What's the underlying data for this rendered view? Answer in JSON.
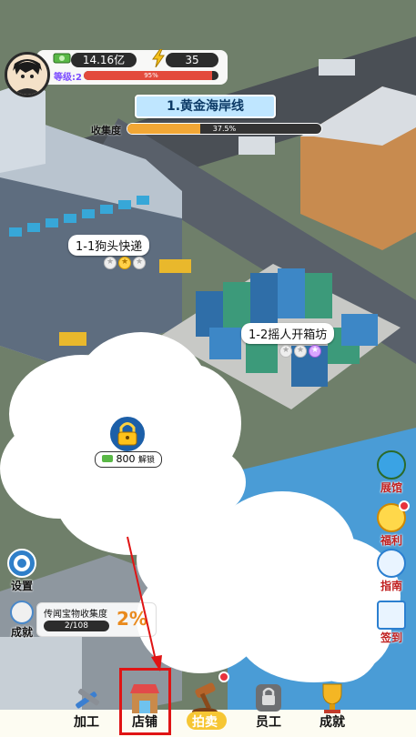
{
  "player": {
    "money": "14.16亿",
    "energy": "35",
    "level": "等级:2",
    "xp_text": "95%",
    "xp_fraction": 0.95
  },
  "map": {
    "area_title": "1.黄金海岸线",
    "collect_label": "收集度",
    "collect_text": "37.5%",
    "collect_fraction": 0.375,
    "shops": [
      {
        "name": "1-1狗头快递"
      },
      {
        "name": "1-2摇人开箱坊"
      }
    ],
    "unlock_cost": "800",
    "unlock_label": "解锁"
  },
  "side_left": {
    "settings": "设置",
    "achievements": "成就"
  },
  "collection_panel": {
    "title": "传闻宝物收集度",
    "progress": "2/108",
    "percent": "2%"
  },
  "side_right": {
    "museum": "展馆",
    "welfare": "福利",
    "guide": "指南",
    "checkin": "签到"
  },
  "nav": {
    "process": "加工",
    "shop": "店铺",
    "auction": "拍卖",
    "staff": "员工",
    "achievement": "成就"
  },
  "colors": {
    "accent_red": "#e01414",
    "collect_fill": "#f2a735",
    "xp_fill": "#e34a3c",
    "banner_bg": "#bfe6ff"
  }
}
